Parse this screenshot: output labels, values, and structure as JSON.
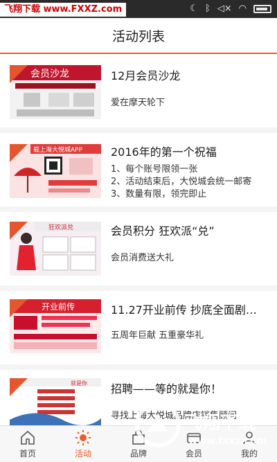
{
  "status_bar": {
    "watermark": "飞翔下载 www.FXXZ.com"
  },
  "header": {
    "title": "活动列表"
  },
  "activities": [
    {
      "title": "12月会员沙龙",
      "lines": [
        "爱在摩天轮下"
      ],
      "thumb_text": "会员沙龙"
    },
    {
      "title": "2016年的第一个祝福",
      "lines": [
        "1、每个账号限领一张",
        "2、活动结束后，大悦城会统一邮寄",
        "3、数量有限，领完即止"
      ],
      "thumb_text": "载上海大悦城APP"
    },
    {
      "title": "会员积分 狂欢派“兑”",
      "lines": [
        "会员消费送大礼"
      ],
      "thumb_text": "狂欢派兑"
    },
    {
      "title": "11.27开业前传 抄底全面剧…",
      "lines": [
        "五周年巨献 五重豪华礼"
      ],
      "thumb_text": "开业前传"
    },
    {
      "title": "招聘——等的就是你！",
      "lines": [
        "寻找上海大悦城品牌店销售顾问"
      ],
      "thumb_text": "就是你"
    }
  ],
  "tabs": [
    {
      "label": "首页",
      "icon": "home-icon",
      "active": false
    },
    {
      "label": "活动",
      "icon": "sun-icon",
      "active": true
    },
    {
      "label": "品牌",
      "icon": "bag-icon",
      "active": false
    },
    {
      "label": "会员",
      "icon": "member-icon",
      "active": false
    },
    {
      "label": "我的",
      "icon": "user-icon",
      "active": false
    }
  ],
  "watermark_logo": {
    "name": "飞翔下载",
    "url": "www.fxxz.com"
  },
  "colors": {
    "accent": "#ec5a2b",
    "status_bar": "#2a2a2a"
  }
}
